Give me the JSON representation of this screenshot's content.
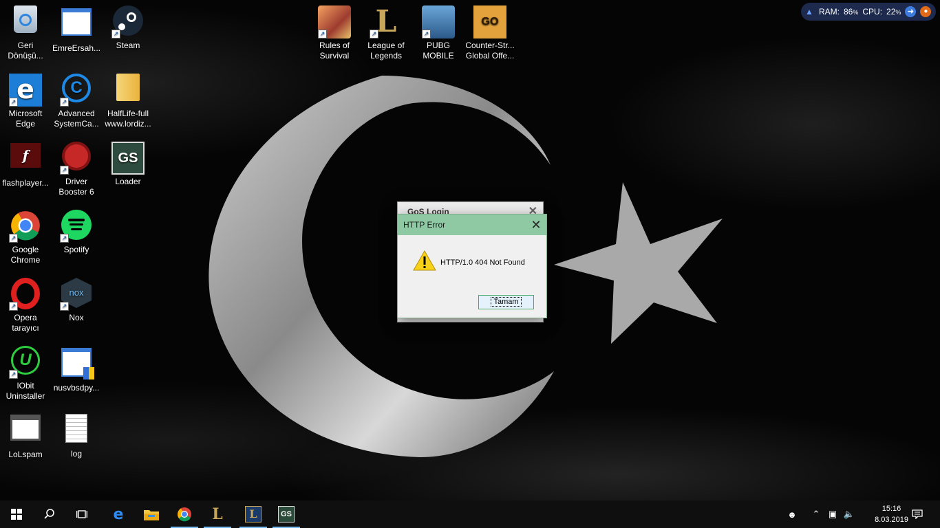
{
  "desktop_icons": [
    {
      "label": "Geri\nDönüşü...",
      "icon": "recycle-bin-icon"
    },
    {
      "label": "EmreErsah...",
      "icon": "window-app-icon"
    },
    {
      "label": "Steam",
      "icon": "steam-icon"
    },
    {
      "label": "Microsoft\nEdge",
      "icon": "edge-icon"
    },
    {
      "label": "Advanced\nSystemCa...",
      "icon": "advanced-systemcare-icon"
    },
    {
      "label": "HalfLife-full\nwww.lordiz...",
      "icon": "folder-icon"
    },
    {
      "label": "flashplayer...",
      "icon": "flash-icon"
    },
    {
      "label": "Driver\nBooster 6",
      "icon": "driver-booster-icon"
    },
    {
      "label": "Loader",
      "icon": "gos-loader-icon"
    },
    {
      "label": "Google\nChrome",
      "icon": "chrome-icon"
    },
    {
      "label": "Spotify",
      "icon": "spotify-icon"
    },
    {
      "label": "Opera\ntarayıcı",
      "icon": "opera-icon"
    },
    {
      "label": "Nox",
      "icon": "nox-icon"
    },
    {
      "label": "IObit\nUninstaller",
      "icon": "iobit-uninstaller-icon"
    },
    {
      "label": "nusvbsdpy...",
      "icon": "installer-icon"
    },
    {
      "label": "LoLspam",
      "icon": "app-window-icon"
    },
    {
      "label": "log",
      "icon": "text-file-icon"
    },
    {
      "label": "Rules of\nSurvival",
      "icon": "rules-of-survival-icon"
    },
    {
      "label": "League of\nLegends",
      "icon": "league-of-legends-icon"
    },
    {
      "label": "PUBG\nMOBILE",
      "icon": "pubg-mobile-icon"
    },
    {
      "label": "Counter-Str...\nGlobal Offe...",
      "icon": "csgo-icon"
    }
  ],
  "widget": {
    "ram_label": "RAM:",
    "ram_value": "86",
    "cpu_label": "CPU:",
    "cpu_value": "22",
    "unit": "%"
  },
  "login_window": {
    "title": "GoS Login"
  },
  "error_dialog": {
    "title": "HTTP Error",
    "message": "HTTP/1.0 404 Not Found",
    "ok_label": "Tamam"
  },
  "taskbar": {
    "items": [
      "start-icon",
      "search-icon",
      "task-view-icon",
      "edge-icon",
      "file-explorer-icon",
      "chrome-icon",
      "league-client-icon",
      "league-game-icon",
      "gos-loader-icon"
    ],
    "time": "15:16",
    "date": "8.03.2019"
  },
  "colors": {
    "accent": "#76b9ed",
    "dialog_title": "#8fc9a3",
    "taskbar": "#0f0f10"
  }
}
